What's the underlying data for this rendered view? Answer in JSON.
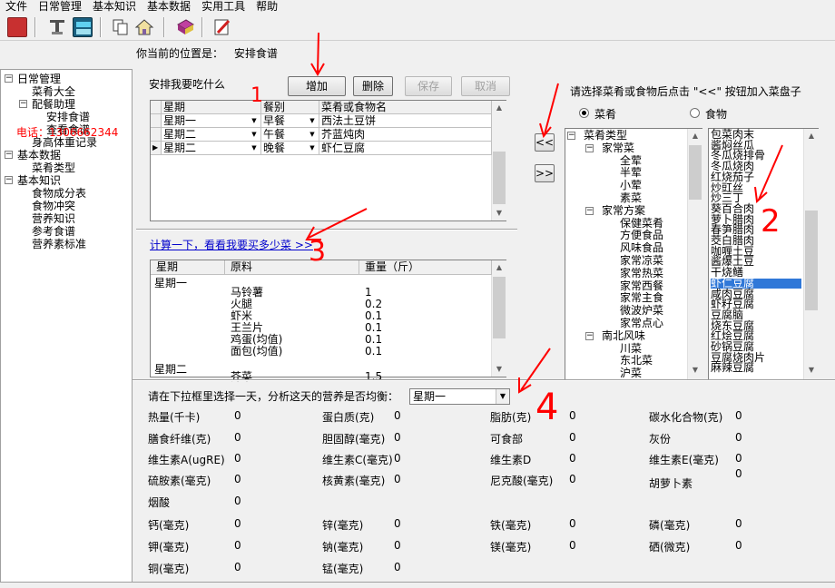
{
  "menu": [
    "文件",
    "日常管理",
    "基本知识",
    "基本数据",
    "实用工具",
    "帮助"
  ],
  "location": {
    "label": "你当前的位置是：",
    "value": "安排食谱"
  },
  "tree": [
    {
      "label": "日常管理",
      "level": 0,
      "exp": "-"
    },
    {
      "label": "菜肴大全",
      "level": 1
    },
    {
      "label": "配餐助理",
      "level": 1,
      "exp": "-"
    },
    {
      "label": "安排食谱",
      "level": 2
    },
    {
      "label": "查看食谱",
      "level": 2
    },
    {
      "label": "身高体重记录",
      "level": 1
    },
    {
      "label": "基本数据",
      "level": 0,
      "exp": "-"
    },
    {
      "label": "菜肴类型",
      "level": 1
    },
    {
      "label": "基本知识",
      "level": 0,
      "exp": "-"
    },
    {
      "label": "食物成分表",
      "level": 1
    },
    {
      "label": "食物冲突",
      "level": 1
    },
    {
      "label": "营养知识",
      "level": 1
    },
    {
      "label": "参考食谱",
      "level": 1
    },
    {
      "label": "营养素标准",
      "level": 1
    }
  ],
  "overlay_text": "电话：1306662344",
  "plan": {
    "title": "安排我要吃什么",
    "buttons": {
      "add": "增加",
      "delete": "删除",
      "save": "保存",
      "cancel": "取消"
    },
    "headers": [
      "星期",
      "餐别",
      "菜肴或食物名"
    ],
    "rows": [
      {
        "day": "星期一",
        "meal": "早餐",
        "food": "西法土豆饼"
      },
      {
        "day": "星期二",
        "meal": "午餐",
        "food": "芥蓝炖肉"
      },
      {
        "day": "星期二",
        "meal": "晚餐",
        "food": "虾仁豆腐"
      }
    ],
    "link": "计算一下，看看我要买多少菜 >>"
  },
  "shopping": {
    "headers": [
      "星期",
      "原料",
      "重量（斤）"
    ],
    "rows": [
      {
        "day": "星期一",
        "item": "",
        "weight": ""
      },
      {
        "day": "",
        "item": "马铃薯",
        "weight": "1"
      },
      {
        "day": "",
        "item": "火腿",
        "weight": "0.2"
      },
      {
        "day": "",
        "item": "虾米",
        "weight": "0.1"
      },
      {
        "day": "",
        "item": "王兰片",
        "weight": "0.1"
      },
      {
        "day": "",
        "item": "鸡蛋(均值)",
        "weight": "0.1"
      },
      {
        "day": "",
        "item": "面包(均值)",
        "weight": "0.1"
      },
      {
        "day": "星期二",
        "item": "",
        "weight": ""
      },
      {
        "day": "",
        "item": "芥菜",
        "weight": "1.5"
      }
    ]
  },
  "picker": {
    "instruction": "请选择菜肴或食物后点击 \"<<\" 按钮加入菜盘子",
    "radio_dish": "菜肴",
    "radio_food": "食物",
    "btn_add": "<<",
    "btn_remove": ">>",
    "type_tree": [
      {
        "label": "菜肴类型",
        "level": 0,
        "exp": "-"
      },
      {
        "label": "家常菜",
        "level": 1,
        "exp": "-"
      },
      {
        "label": "全荤",
        "level": 2
      },
      {
        "label": "半荤",
        "level": 2
      },
      {
        "label": "小荤",
        "level": 2
      },
      {
        "label": "素菜",
        "level": 2
      },
      {
        "label": "家常方案",
        "level": 1,
        "exp": "-"
      },
      {
        "label": "保健菜肴",
        "level": 2
      },
      {
        "label": "方便食品",
        "level": 2
      },
      {
        "label": "风味食品",
        "level": 2
      },
      {
        "label": "家常凉菜",
        "level": 2
      },
      {
        "label": "家常热菜",
        "level": 2
      },
      {
        "label": "家常西餐",
        "level": 2
      },
      {
        "label": "家常主食",
        "level": 2
      },
      {
        "label": "微波炉菜",
        "level": 2
      },
      {
        "label": "家常点心",
        "level": 2
      },
      {
        "label": "南北风味",
        "level": 1,
        "exp": "-"
      },
      {
        "label": "川菜",
        "level": 2
      },
      {
        "label": "东北菜",
        "level": 2
      },
      {
        "label": "沪菜",
        "level": 2
      }
    ],
    "dishes": [
      "包菜肉末",
      "酱焖丝瓜",
      "冬瓜烧排骨",
      "冬瓜烧肉",
      "红烧茄子",
      "炒豇丝",
      "炒三丁",
      "葵百合肉",
      "萝卜腊肉",
      "春笋腊肉",
      "茭白腊肉",
      "咖喱土豆",
      "酱爆土豆",
      "干烧鳝",
      "虾仁豆腐",
      "咸肉豆腐",
      "虾籽豆腐",
      "豆腐脑",
      "烧东豆腐",
      "红烩豆腐",
      "砂锅豆腐",
      "豆腐烧肉片",
      "麻辣豆腐"
    ],
    "selected_index": 14
  },
  "nutrition": {
    "prompt": "请在下拉框里选择一天，分析这天的营养是否均衡：",
    "day": "星期一",
    "items": [
      {
        "label": "热量(千卡)",
        "value": "0"
      },
      {
        "label": "蛋白质(克)",
        "value": "0"
      },
      {
        "label": "脂肪(克)",
        "value": "0"
      },
      {
        "label": "碳水化合物(克)",
        "value": "0"
      },
      {
        "label": "膳食纤维(克)",
        "value": "0"
      },
      {
        "label": "胆固醇(毫克)",
        "value": "0"
      },
      {
        "label": "可食部",
        "value": "0"
      },
      {
        "label": "灰份",
        "value": "0"
      },
      {
        "label": "维生素A(ugRE)",
        "value": "0"
      },
      {
        "label": "维生素C(毫克)",
        "value": "0"
      },
      {
        "label": "维生素D",
        "value": "0"
      },
      {
        "label": "维生素E(毫克)",
        "value": "0"
      },
      {
        "label": "硫胺素(毫克)",
        "value": "0"
      },
      {
        "label": "核黄素(毫克)",
        "value": "0"
      },
      {
        "label": "尼克酸(毫克)",
        "value": "0"
      },
      {
        "label": "胡萝卜素",
        "value": "0"
      },
      {
        "label": "烟酸",
        "value": "0"
      },
      {
        "label": "钙(毫克)",
        "value": "0"
      },
      {
        "label": "锌(毫克)",
        "value": "0"
      },
      {
        "label": "铁(毫克)",
        "value": "0"
      },
      {
        "label": "磷(毫克)",
        "value": "0"
      },
      {
        "label": "钾(毫克)",
        "value": "0"
      },
      {
        "label": "钠(毫克)",
        "value": "0"
      },
      {
        "label": "镁(毫克)",
        "value": "0"
      },
      {
        "label": "硒(微克)",
        "value": "0"
      },
      {
        "label": "铜(毫克)",
        "value": "0"
      },
      {
        "label": "锰(毫克)",
        "value": "0"
      }
    ]
  },
  "annotations": [
    "1",
    "2",
    "3",
    "4"
  ],
  "colors": {
    "annotation": "#ff0000",
    "selection": "#3078d8",
    "link": "#0000cc"
  }
}
